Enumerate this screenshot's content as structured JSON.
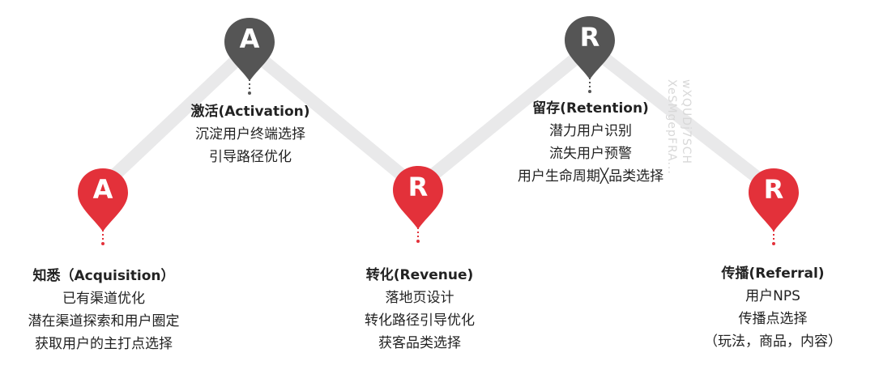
{
  "colors": {
    "accent_red": "#e3313a",
    "dark_grey": "#555555",
    "line_grey": "#e9e9ea"
  },
  "stages": [
    {
      "id": "acquisition",
      "letter": "A",
      "color": "#e3313a",
      "title": "知悉（Acquisition）",
      "lines": [
        "已有渠道优化",
        "潜在渠道探索和用户圈定",
        "获取用户的主打点选择"
      ]
    },
    {
      "id": "activation",
      "letter": "A",
      "color": "#555555",
      "title": "激活(Activation)",
      "lines": [
        "沉淀用户终端选择",
        "引导路径优化"
      ]
    },
    {
      "id": "revenue",
      "letter": "R",
      "color": "#e3313a",
      "title": "转化(Revenue)",
      "lines": [
        "落地页设计",
        "转化路径引导优化",
        "获客品类选择"
      ]
    },
    {
      "id": "retention",
      "letter": "R",
      "color": "#555555",
      "title": "留存(Retention)",
      "lines": [
        "潜力用户识别",
        "流失用户预警",
        "用户生命周期╳品类选择"
      ]
    },
    {
      "id": "referral",
      "letter": "R",
      "color": "#e3313a",
      "title": "传播(Referral)",
      "lines": [
        "用户NPS",
        "传播点选择",
        "（玩法，商品，内容）"
      ]
    }
  ],
  "watermark": {
    "text": "wXQUDj7SCH XeSMgepFRA..."
  }
}
